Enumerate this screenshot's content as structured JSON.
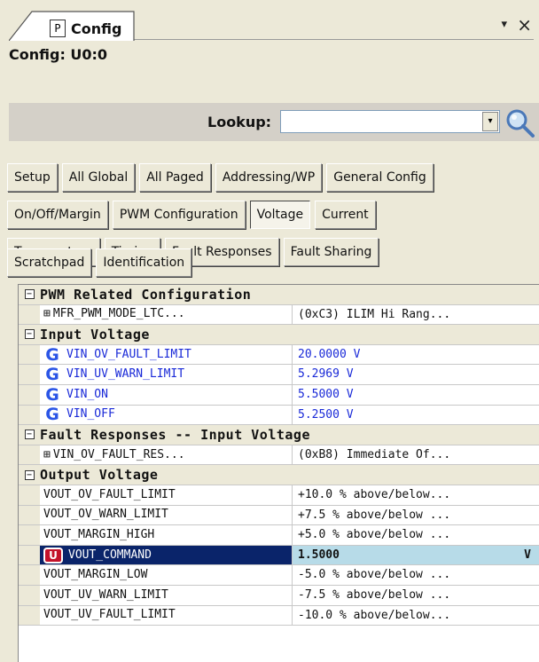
{
  "tab": {
    "letter": "P",
    "title": "Config"
  },
  "window_controls": {
    "pin": "▾",
    "close": "×"
  },
  "context_label": "Config: U0:0",
  "lookup": {
    "label": "Lookup:",
    "value": "",
    "dropdown_glyph": "▾"
  },
  "button_rows": [
    [
      "Setup",
      "All Global",
      "All Paged",
      "Addressing/WP",
      "General Config"
    ],
    [
      "On/Off/Margin",
      "PWM Configuration",
      "Voltage",
      "Current"
    ],
    [
      "Temperature",
      "Timing",
      "Fault Responses",
      "Fault Sharing"
    ],
    [
      "Scratchpad",
      "Identification"
    ]
  ],
  "active_button": "Voltage",
  "grid": {
    "sections": [
      {
        "title": "PWM Related Configuration",
        "expanded_glyph": "−",
        "rows": [
          {
            "name": "MFR_PWM_MODE_LTC...",
            "value": "(0xC3) ILIM Hi Rang...",
            "expandable": true
          }
        ]
      },
      {
        "title": "Input Voltage",
        "expanded_glyph": "−",
        "rows": [
          {
            "name": "VIN_OV_FAULT_LIMIT",
            "value": "20.0000 V",
            "icon": "G",
            "style": "blue"
          },
          {
            "name": "VIN_UV_WARN_LIMIT",
            "value": "5.2969 V",
            "icon": "G",
            "style": "blue"
          },
          {
            "name": "VIN_ON",
            "value": "5.5000 V",
            "icon": "G",
            "style": "blue"
          },
          {
            "name": "VIN_OFF",
            "value": "5.2500 V",
            "icon": "G",
            "style": "blue"
          }
        ]
      },
      {
        "title": "Fault Responses -- Input Voltage",
        "expanded_glyph": "−",
        "rows": [
          {
            "name": "VIN_OV_FAULT_RES...",
            "value": "(0xB8) Immediate Of...",
            "expandable": true
          }
        ]
      },
      {
        "title": "Output Voltage",
        "expanded_glyph": "−",
        "rows": [
          {
            "name": "VOUT_OV_FAULT_LIMIT",
            "value": "+10.0 % above/below..."
          },
          {
            "name": "VOUT_OV_WARN_LIMIT",
            "value": "+7.5 % above/below ..."
          },
          {
            "name": "VOUT_MARGIN_HIGH",
            "value": "+5.0 % above/below ..."
          },
          {
            "name": "VOUT_COMMAND",
            "value": "1.5000",
            "unit": "V",
            "icon": "U",
            "selected": true
          },
          {
            "name": "VOUT_MARGIN_LOW",
            "value": "-5.0 % above/below ..."
          },
          {
            "name": "VOUT_UV_WARN_LIMIT",
            "value": "-7.5 % above/below ..."
          },
          {
            "name": "VOUT_UV_FAULT_LIMIT",
            "value": "-10.0 % above/below..."
          }
        ]
      }
    ]
  },
  "colors": {
    "panel_bg": "#ece9d8",
    "selection_bg": "#0a246a",
    "selected_value_bg": "#b7dbe8",
    "global_icon": "#2b55e6",
    "user_icon": "#c3122a",
    "link_text": "#1a2ad8"
  }
}
